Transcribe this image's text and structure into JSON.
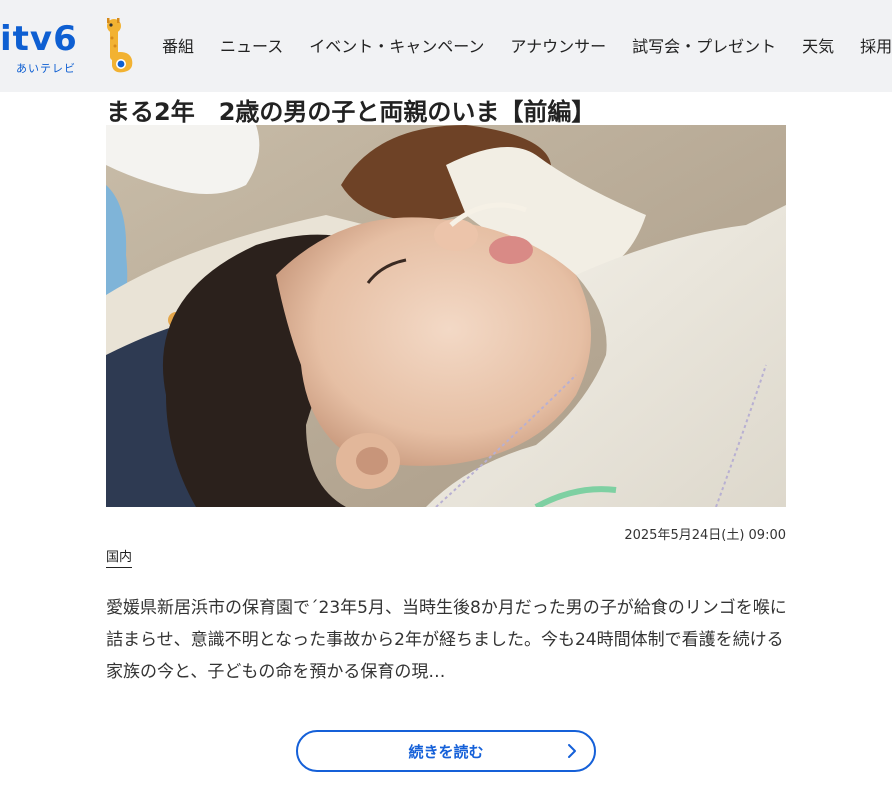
{
  "header": {
    "logo": {
      "text": "itv6",
      "sub": "あいテレビ"
    },
    "nav": [
      {
        "label": "番組"
      },
      {
        "label": "ニュース"
      },
      {
        "label": "イベント・キャンペーン"
      },
      {
        "label": "アナウンサー"
      },
      {
        "label": "試写会・プレゼント"
      },
      {
        "label": "天気"
      },
      {
        "label": "採用情報"
      }
    ]
  },
  "article": {
    "title": "まる2年　2歳の男の子と両親のいま【前編】",
    "image_icon": "photo-sleeping-child",
    "date": "2025年5月24日(土) 09:00",
    "category": "国内",
    "summary": "愛媛県新居浜市の保育園で´23年5月、当時生後8か月だった男の子が給食のリンゴを喉に詰まらせ、意識不明となった事故から2年が経ちました。今も24時間体制で看護を続ける家族の今と、子どもの命を預かる保育の現…",
    "read_more": "続きを読む"
  },
  "colors": {
    "brand": "#0e5fd2",
    "button_border": "#1560d8",
    "header_bg": "#f1f2f4"
  }
}
